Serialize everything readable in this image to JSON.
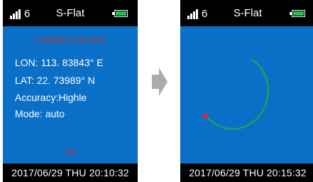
{
  "left_device": {
    "status": {
      "signal_count": "6",
      "title": "S-Flat",
      "battery_color": "#22c04a"
    },
    "screen": {
      "heading": "Location success",
      "lon_label": "LON:",
      "lon_value": "113. 83843° E",
      "lat_label": "LAT:",
      "lat_value": "22. 73989° N",
      "accuracy": "Accuracy:Highle",
      "mode_label": "Mode:",
      "mode_value": "auto",
      "countdown": "2S"
    },
    "footer": {
      "date": "2017/06/29",
      "day": "THU",
      "time": "20:10:32"
    }
  },
  "right_device": {
    "status": {
      "signal_count": "6",
      "title": "S-Flat",
      "battery_color": "#22c04a"
    },
    "screen": {
      "track_color": "#1fa05a",
      "start_point_color": "#e0262b"
    },
    "footer": {
      "date": "2017/06/29",
      "day": "THU",
      "time": "20:15:32"
    }
  },
  "colors": {
    "screen_bg": "#0a6fc7",
    "accent_red": "#b8323a",
    "arrow_gray": "#a9acb0"
  }
}
